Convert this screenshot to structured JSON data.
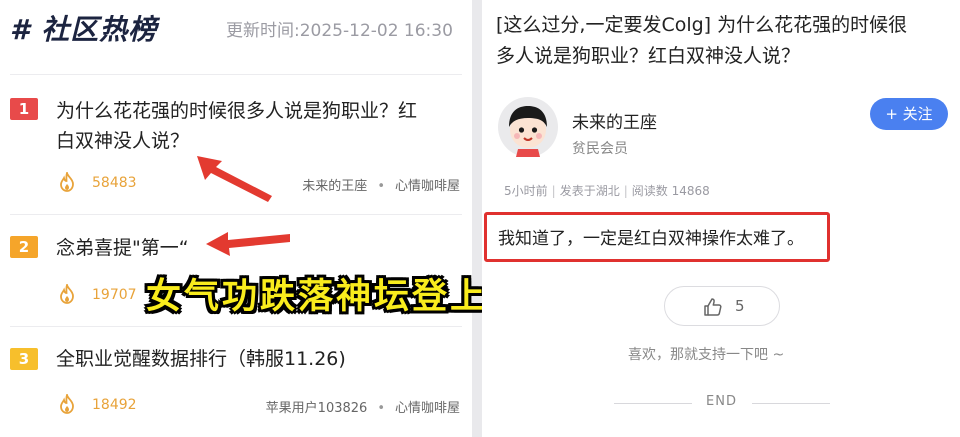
{
  "left": {
    "header": {
      "title": "# 社区热榜",
      "update_time": "更新时间:2025-12-02 16:30"
    },
    "items": [
      {
        "rank": "1",
        "title_line1": "为什么花花强的时候很多人说是狗职业？红",
        "title_line2": "白双神没人说？",
        "heat": "58483",
        "author": "未来的王座",
        "board": "心情咖啡屋",
        "dot": "•"
      },
      {
        "rank": "2",
        "title_line1": "念弟喜提\"第一“",
        "heat": "19707"
      },
      {
        "rank": "3",
        "title_line1": "全职业觉醒数据排行（韩服11.26)",
        "heat": "18492",
        "author": "苹果用户103826",
        "board": "心情咖啡屋",
        "dot": "•"
      }
    ],
    "fire_icon": "fire-icon",
    "accent_colors": {
      "rank1": "#e84a4a",
      "rank2": "#f5a52a",
      "rank3": "#f7bf2c",
      "heat": "#e8a33a"
    }
  },
  "caption": "女气功跌落神坛登上热搜",
  "right": {
    "post_title_line1": "[这么过分,一定要发Colg] 为什么花花强的时候很",
    "post_title_line2": "多人说是狗职业？红白双神没人说？",
    "user": {
      "name": "未来的王座",
      "level": "贫民会员"
    },
    "follow_label": "+ 关注",
    "post_info": {
      "time": "5小时前",
      "location": "发表于湖北",
      "reads": "阅读数 14868",
      "sep": "|"
    },
    "quote": "我知道了，一定是红白双神操作太难了。",
    "like_count": "5",
    "like_tip": "喜欢，那就支持一下吧 ~",
    "end": "END",
    "follow_color": "#4a80f0",
    "highlight_color": "#e0312f"
  }
}
